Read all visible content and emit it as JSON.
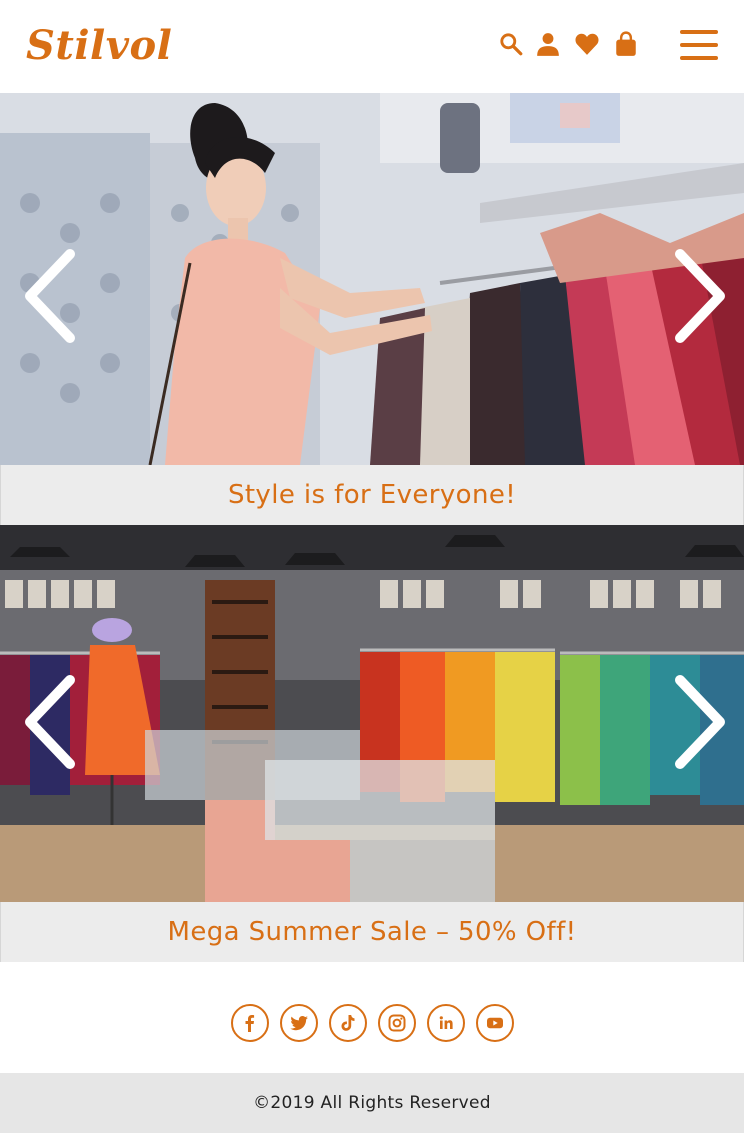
{
  "brand": {
    "name": "Stilvol",
    "accent_color": "#d86f15"
  },
  "header": {
    "icons": [
      "search-icon",
      "user-icon",
      "heart-icon",
      "shopping-bag-icon",
      "hamburger-menu-icon"
    ]
  },
  "slides": [
    {
      "caption": "Style is for Everyone!",
      "image": "woman-browsing-clothing-rack-photo"
    },
    {
      "caption": "Mega Summer Sale – 50% Off!",
      "image": "clothing-store-interior-photo"
    }
  ],
  "carousel": {
    "prev_icon": "chevron-left-icon",
    "next_icon": "chevron-right-icon"
  },
  "social": {
    "links": [
      "facebook-icon",
      "twitter-icon",
      "tiktok-icon",
      "instagram-icon",
      "linkedin-icon",
      "youtube-icon"
    ]
  },
  "footer": {
    "copyright": "©2019 All Rights Reserved"
  }
}
